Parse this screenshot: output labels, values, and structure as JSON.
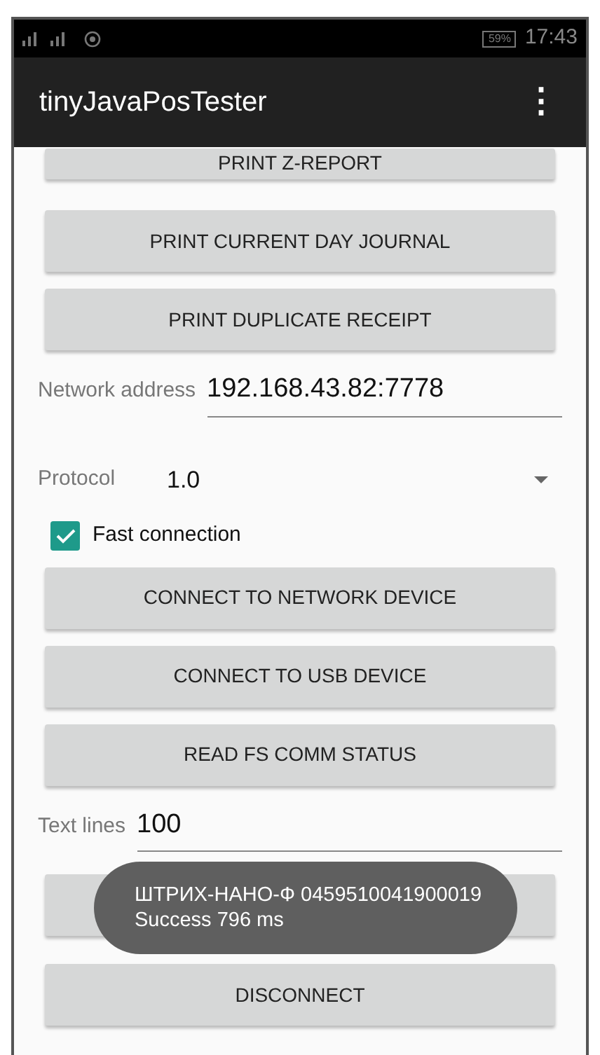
{
  "status_bar": {
    "battery": "59%",
    "time": "17:43"
  },
  "app_bar": {
    "title": "tinyJavaPosTester",
    "menu_icon": "⋮"
  },
  "items": [
    {
      "kind": "button",
      "label": "PRINT Z-REPORT"
    },
    {
      "kind": "button",
      "label": "PRINT CURRENT DAY JOURNAL"
    },
    {
      "kind": "button",
      "label": "PRINT DUPLICATE RECEIPT"
    },
    {
      "kind": "field",
      "label": "Network address",
      "value": "192.168.43.82:7778"
    },
    {
      "kind": "dropdown",
      "label": "Protocol",
      "value": "1.0"
    },
    {
      "kind": "checkbox",
      "label": "Fast connection",
      "checked": true
    },
    {
      "kind": "button",
      "label": "CONNECT TO NETWORK DEVICE"
    },
    {
      "kind": "button",
      "label": "CONNECT TO USB DEVICE"
    },
    {
      "kind": "button",
      "label": "READ FS COMM STATUS"
    },
    {
      "kind": "field",
      "label": "Text lines",
      "value": "100"
    },
    {
      "kind": "button"
    },
    {
      "kind": "button",
      "label": "DISCONNECT"
    }
  ],
  "toast": {
    "lines": [
      "ШТРИХ-НАНО-Ф 0459510041900019",
      "Success 796 ms"
    ]
  }
}
